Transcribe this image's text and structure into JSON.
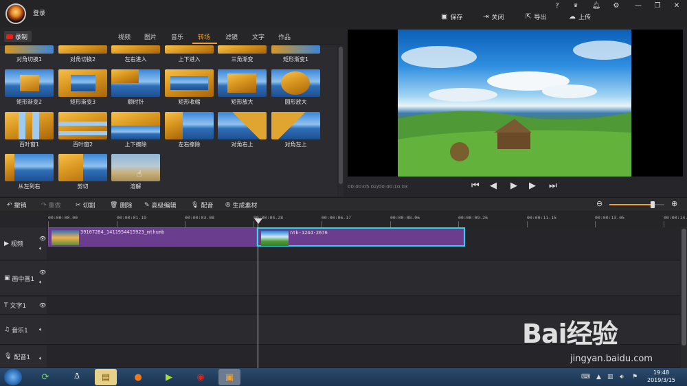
{
  "header": {
    "login": "登录",
    "actions": {
      "save": "保存",
      "close": "关闭",
      "export": "导出",
      "upload": "上传"
    },
    "icons": {
      "help": "?",
      "vip": "VIP"
    }
  },
  "tabs": {
    "record": "录制",
    "items": [
      "视频",
      "图片",
      "音乐",
      "转场",
      "滤镜",
      "文字",
      "作品"
    ],
    "active": "转场"
  },
  "library": {
    "row0": [
      "对角切换1",
      "对角切换2",
      "左右进入",
      "上下进入",
      "三角渐变",
      "矩形渐变1"
    ],
    "row1": [
      "矩形渐变2",
      "矩形渐变3",
      "顺时针",
      "矩形收缩",
      "矩形放大",
      "圆形放大"
    ],
    "row2": [
      "百叶窗1",
      "百叶窗2",
      "上下擦除",
      "左右擦除",
      "对角右上",
      "对角左上"
    ],
    "row3": [
      "从左到右",
      "剪切",
      "溶解"
    ]
  },
  "preview": {
    "time": "00:00:05.02/00:00:10.03"
  },
  "toolbar": {
    "undo": "撤销",
    "redo": "重做",
    "cut": "切割",
    "delete": "删除",
    "advanced": "高级编辑",
    "dub": "配音",
    "generate": "生成素材"
  },
  "ruler": [
    "00:00:00.00",
    "00:00:01.19",
    "00:00:03.08",
    "00:00:04.28",
    "00:00:06.17",
    "00:00:08.06",
    "00:00:09.26",
    "00:00:11.15",
    "00:00:13.05",
    "00:00:14."
  ],
  "tracks": {
    "video": "视频",
    "pip": "画中画1",
    "text": "文字1",
    "music": "音乐1",
    "voice": "配音1"
  },
  "clips": {
    "clip1": "39107284_1411954415923_mthumb",
    "clip2": "ntk-1244-2676"
  },
  "zoom": {
    "level": 0.78
  },
  "watermark": {
    "brand": "Bai经验",
    "url": "jingyan.baidu.com"
  },
  "taskbar": {
    "time": "19:48",
    "date": "2019/3/15"
  },
  "colors": {
    "accent": "#f0a030",
    "clip": "#6a3d8f",
    "selected": "#2fd0e8",
    "record": "#e2231a"
  }
}
